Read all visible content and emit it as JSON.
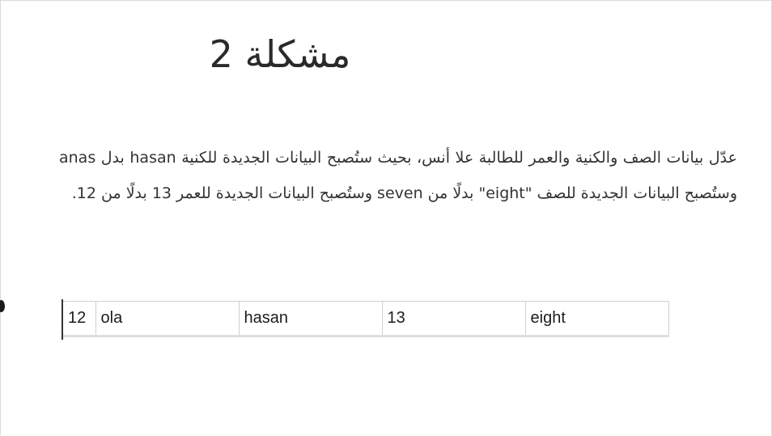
{
  "title": "مشكلة 2",
  "paragraph": "عدّل بيانات الصف والكنية والعمر للطالبة علا أنس، بحيث ستُصبح البيانات الجديدة للكنية hasan بدل anas وستُصبح البيانات الجديدة للصف \"eight\" بدلًا من seven وستُصبح البيانات الجديدة للعمر 13 بدلًا من 12.",
  "table": {
    "row": {
      "id": "12",
      "first_name": "ola",
      "last_name": "hasan",
      "age": "13",
      "class": "eight"
    }
  }
}
